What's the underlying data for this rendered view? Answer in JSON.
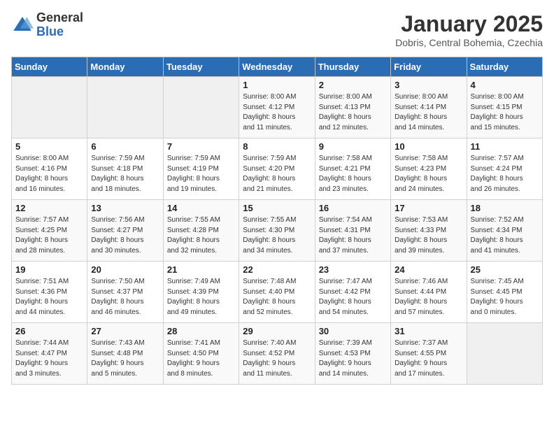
{
  "logo": {
    "general": "General",
    "blue": "Blue"
  },
  "title": "January 2025",
  "location": "Dobris, Central Bohemia, Czechia",
  "days_of_week": [
    "Sunday",
    "Monday",
    "Tuesday",
    "Wednesday",
    "Thursday",
    "Friday",
    "Saturday"
  ],
  "weeks": [
    [
      {
        "day": "",
        "info": ""
      },
      {
        "day": "",
        "info": ""
      },
      {
        "day": "",
        "info": ""
      },
      {
        "day": "1",
        "info": "Sunrise: 8:00 AM\nSunset: 4:12 PM\nDaylight: 8 hours\nand 11 minutes."
      },
      {
        "day": "2",
        "info": "Sunrise: 8:00 AM\nSunset: 4:13 PM\nDaylight: 8 hours\nand 12 minutes."
      },
      {
        "day": "3",
        "info": "Sunrise: 8:00 AM\nSunset: 4:14 PM\nDaylight: 8 hours\nand 14 minutes."
      },
      {
        "day": "4",
        "info": "Sunrise: 8:00 AM\nSunset: 4:15 PM\nDaylight: 8 hours\nand 15 minutes."
      }
    ],
    [
      {
        "day": "5",
        "info": "Sunrise: 8:00 AM\nSunset: 4:16 PM\nDaylight: 8 hours\nand 16 minutes."
      },
      {
        "day": "6",
        "info": "Sunrise: 7:59 AM\nSunset: 4:18 PM\nDaylight: 8 hours\nand 18 minutes."
      },
      {
        "day": "7",
        "info": "Sunrise: 7:59 AM\nSunset: 4:19 PM\nDaylight: 8 hours\nand 19 minutes."
      },
      {
        "day": "8",
        "info": "Sunrise: 7:59 AM\nSunset: 4:20 PM\nDaylight: 8 hours\nand 21 minutes."
      },
      {
        "day": "9",
        "info": "Sunrise: 7:58 AM\nSunset: 4:21 PM\nDaylight: 8 hours\nand 23 minutes."
      },
      {
        "day": "10",
        "info": "Sunrise: 7:58 AM\nSunset: 4:23 PM\nDaylight: 8 hours\nand 24 minutes."
      },
      {
        "day": "11",
        "info": "Sunrise: 7:57 AM\nSunset: 4:24 PM\nDaylight: 8 hours\nand 26 minutes."
      }
    ],
    [
      {
        "day": "12",
        "info": "Sunrise: 7:57 AM\nSunset: 4:25 PM\nDaylight: 8 hours\nand 28 minutes."
      },
      {
        "day": "13",
        "info": "Sunrise: 7:56 AM\nSunset: 4:27 PM\nDaylight: 8 hours\nand 30 minutes."
      },
      {
        "day": "14",
        "info": "Sunrise: 7:55 AM\nSunset: 4:28 PM\nDaylight: 8 hours\nand 32 minutes."
      },
      {
        "day": "15",
        "info": "Sunrise: 7:55 AM\nSunset: 4:30 PM\nDaylight: 8 hours\nand 34 minutes."
      },
      {
        "day": "16",
        "info": "Sunrise: 7:54 AM\nSunset: 4:31 PM\nDaylight: 8 hours\nand 37 minutes."
      },
      {
        "day": "17",
        "info": "Sunrise: 7:53 AM\nSunset: 4:33 PM\nDaylight: 8 hours\nand 39 minutes."
      },
      {
        "day": "18",
        "info": "Sunrise: 7:52 AM\nSunset: 4:34 PM\nDaylight: 8 hours\nand 41 minutes."
      }
    ],
    [
      {
        "day": "19",
        "info": "Sunrise: 7:51 AM\nSunset: 4:36 PM\nDaylight: 8 hours\nand 44 minutes."
      },
      {
        "day": "20",
        "info": "Sunrise: 7:50 AM\nSunset: 4:37 PM\nDaylight: 8 hours\nand 46 minutes."
      },
      {
        "day": "21",
        "info": "Sunrise: 7:49 AM\nSunset: 4:39 PM\nDaylight: 8 hours\nand 49 minutes."
      },
      {
        "day": "22",
        "info": "Sunrise: 7:48 AM\nSunset: 4:40 PM\nDaylight: 8 hours\nand 52 minutes."
      },
      {
        "day": "23",
        "info": "Sunrise: 7:47 AM\nSunset: 4:42 PM\nDaylight: 8 hours\nand 54 minutes."
      },
      {
        "day": "24",
        "info": "Sunrise: 7:46 AM\nSunset: 4:44 PM\nDaylight: 8 hours\nand 57 minutes."
      },
      {
        "day": "25",
        "info": "Sunrise: 7:45 AM\nSunset: 4:45 PM\nDaylight: 9 hours\nand 0 minutes."
      }
    ],
    [
      {
        "day": "26",
        "info": "Sunrise: 7:44 AM\nSunset: 4:47 PM\nDaylight: 9 hours\nand 3 minutes."
      },
      {
        "day": "27",
        "info": "Sunrise: 7:43 AM\nSunset: 4:48 PM\nDaylight: 9 hours\nand 5 minutes."
      },
      {
        "day": "28",
        "info": "Sunrise: 7:41 AM\nSunset: 4:50 PM\nDaylight: 9 hours\nand 8 minutes."
      },
      {
        "day": "29",
        "info": "Sunrise: 7:40 AM\nSunset: 4:52 PM\nDaylight: 9 hours\nand 11 minutes."
      },
      {
        "day": "30",
        "info": "Sunrise: 7:39 AM\nSunset: 4:53 PM\nDaylight: 9 hours\nand 14 minutes."
      },
      {
        "day": "31",
        "info": "Sunrise: 7:37 AM\nSunset: 4:55 PM\nDaylight: 9 hours\nand 17 minutes."
      },
      {
        "day": "",
        "info": ""
      }
    ]
  ]
}
